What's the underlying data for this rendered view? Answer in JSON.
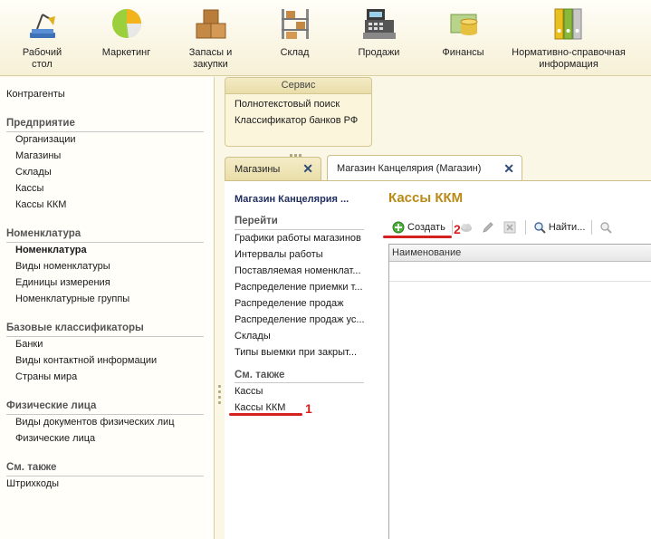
{
  "toolbar": {
    "items": [
      {
        "label": "Рабочий\nстол",
        "icon": "desktop-lamp-icon"
      },
      {
        "label": "Маркетинг",
        "icon": "pie-chart-icon"
      },
      {
        "label": "Запасы и\nзакупки",
        "icon": "boxes-icon"
      },
      {
        "label": "Склад",
        "icon": "warehouse-shelf-icon"
      },
      {
        "label": "Продажи",
        "icon": "cash-register-icon"
      },
      {
        "label": "Финансы",
        "icon": "coins-icon"
      },
      {
        "label": "Нормативно-справочная\nинформация",
        "icon": "binders-icon"
      }
    ]
  },
  "sidebar": {
    "top_link": "Контрагенты",
    "groups": [
      {
        "title": "Предприятие",
        "items": [
          "Организации",
          "Магазины",
          "Склады",
          "Кассы",
          "Кассы ККМ"
        ]
      },
      {
        "title": "Номенклатура",
        "items": [
          "Номенклатура",
          "Виды номенклатуры",
          "Единицы измерения",
          "Номенклатурные группы"
        ]
      },
      {
        "title": "Базовые классификаторы",
        "items": [
          "Банки",
          "Виды контактной информации",
          "Страны мира"
        ]
      },
      {
        "title": "Физические лица",
        "items": [
          "Виды документов физических лиц",
          "Физические лица"
        ]
      },
      {
        "title": "См. также",
        "items": [
          "Штрихкоды"
        ]
      }
    ]
  },
  "service": {
    "title": "Сервис",
    "links": [
      "Полнотекстовый поиск",
      "Классификатор банков РФ"
    ]
  },
  "tabs": [
    {
      "label": "Магазины",
      "active": false
    },
    {
      "label": "Магазин Канцелярия (Магазин)",
      "active": true
    }
  ],
  "nav": {
    "title": "Магазин Канцелярия ...",
    "goto_title": "Перейти",
    "goto_links": [
      "Графики работы магазинов",
      "Интервалы работы",
      "Поставляемая номенклат...",
      "Распределение приемки т...",
      "Распределение продаж",
      "Распределение продаж ус...",
      "Склады",
      "Типы выемки при закрыт..."
    ],
    "see_also_title": "См. также",
    "see_also_links": [
      "Кассы",
      "Кассы ККМ"
    ]
  },
  "form": {
    "title": "Кассы ККМ",
    "create_label": "Создать",
    "find_label": "Найти...",
    "column_header": "Наименование"
  },
  "annotations": {
    "marker_1": "1",
    "marker_2": "2",
    "color": "#d52020"
  },
  "colors": {
    "accent_title": "#b88a16",
    "nav_title": "#1e2d5e"
  }
}
